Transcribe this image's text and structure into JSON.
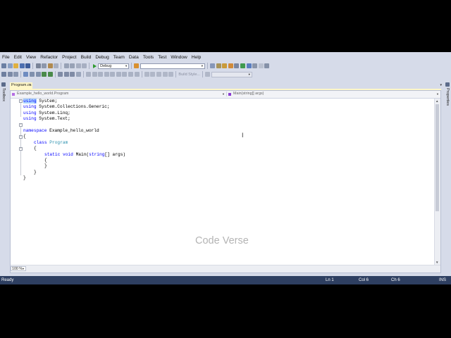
{
  "menu": [
    "File",
    "Edit",
    "View",
    "Refactor",
    "Project",
    "Build",
    "Debug",
    "Team",
    "Data",
    "Tools",
    "Test",
    "Window",
    "Help"
  ],
  "toolbar": {
    "config_value": "Debug",
    "build_style_label": "Build Style..."
  },
  "side": {
    "toolbox_label": "Toolbox",
    "properties_label": "Properties"
  },
  "tab": {
    "name": "Program.cs",
    "close_glyph": "×",
    "dropdown_glyph": "▾"
  },
  "nav": {
    "left": "Example_hello_world.Program",
    "right": "Main(string[] args)"
  },
  "code": {
    "l1_kw": "using",
    "l1_rest": " System;",
    "l2_kw": "using",
    "l2_rest": " System.Collections.Generic;",
    "l3_kw": "using",
    "l3_rest": " System.Linq;",
    "l4_kw": "using",
    "l4_rest": " System.Text;",
    "l6_kw": "namespace",
    "l6_rest": " Example_hello_world",
    "l7": "{",
    "l8_kw": "class",
    "l8_type": "Program",
    "l9": "{",
    "l10_kw": "static void",
    "l10_a": " Main(",
    "l10_kw2": "string",
    "l10_b": "[] args)",
    "l11": "{",
    "l12": "}",
    "l13": "}",
    "l14": "}"
  },
  "cursor_glyph": "I",
  "watermark": "Code Verse",
  "zoom": "100 %",
  "status": {
    "ready": "Ready",
    "ln": "Ln 1",
    "col": "Col 6",
    "ch": "Ch 6",
    "ins": "INS"
  },
  "colors": {
    "ide_background": "#d6dbe9",
    "status_bar": "#2e3f61",
    "active_tab": "#fff7c8",
    "keyword": "#0000ff",
    "type": "#2b91af",
    "selection": "#add6ff",
    "watermark": "#b4b4b4"
  }
}
